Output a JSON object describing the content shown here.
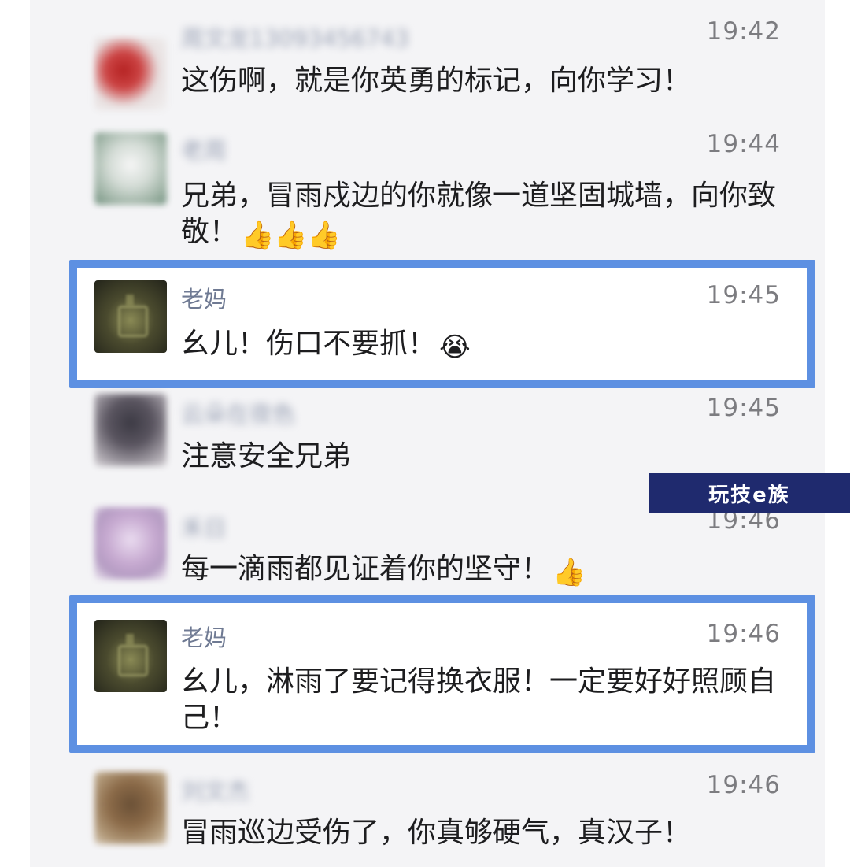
{
  "comments": [
    {
      "name": "周文龙13093456743",
      "time": "19:42",
      "text": "这伤啊，就是你英勇的标记，向你学习！",
      "emoji": ""
    },
    {
      "name": "老周",
      "time": "19:44",
      "text": "兄弟，冒雨戍边的你就像一道坚固城墙，向你致敬！",
      "emoji": "👍👍👍"
    },
    {
      "name": "老妈",
      "time": "19:45",
      "text": "幺儿！伤口不要抓！",
      "emoji": "😭"
    },
    {
      "name": "云朵在夜色",
      "time": "19:45",
      "text": "注意安全兄弟",
      "emoji": ""
    },
    {
      "name": "禾日",
      "time": "19:46",
      "text": "每一滴雨都见证着你的坚守！",
      "emoji": "👍"
    },
    {
      "name": "老妈",
      "time": "19:46",
      "text": "幺儿，淋雨了要记得换衣服！一定要好好照顾自己！",
      "emoji": ""
    },
    {
      "name": "刘文杰",
      "time": "19:46",
      "text": "冒雨巡边受伤了，你真够硬气，真汉子！",
      "emoji": ""
    }
  ],
  "watermark": "玩技e族",
  "colors": {
    "highlight": "#5d90e2",
    "name": "#6f7a93",
    "watermark_bg": "#1f2a6e"
  }
}
